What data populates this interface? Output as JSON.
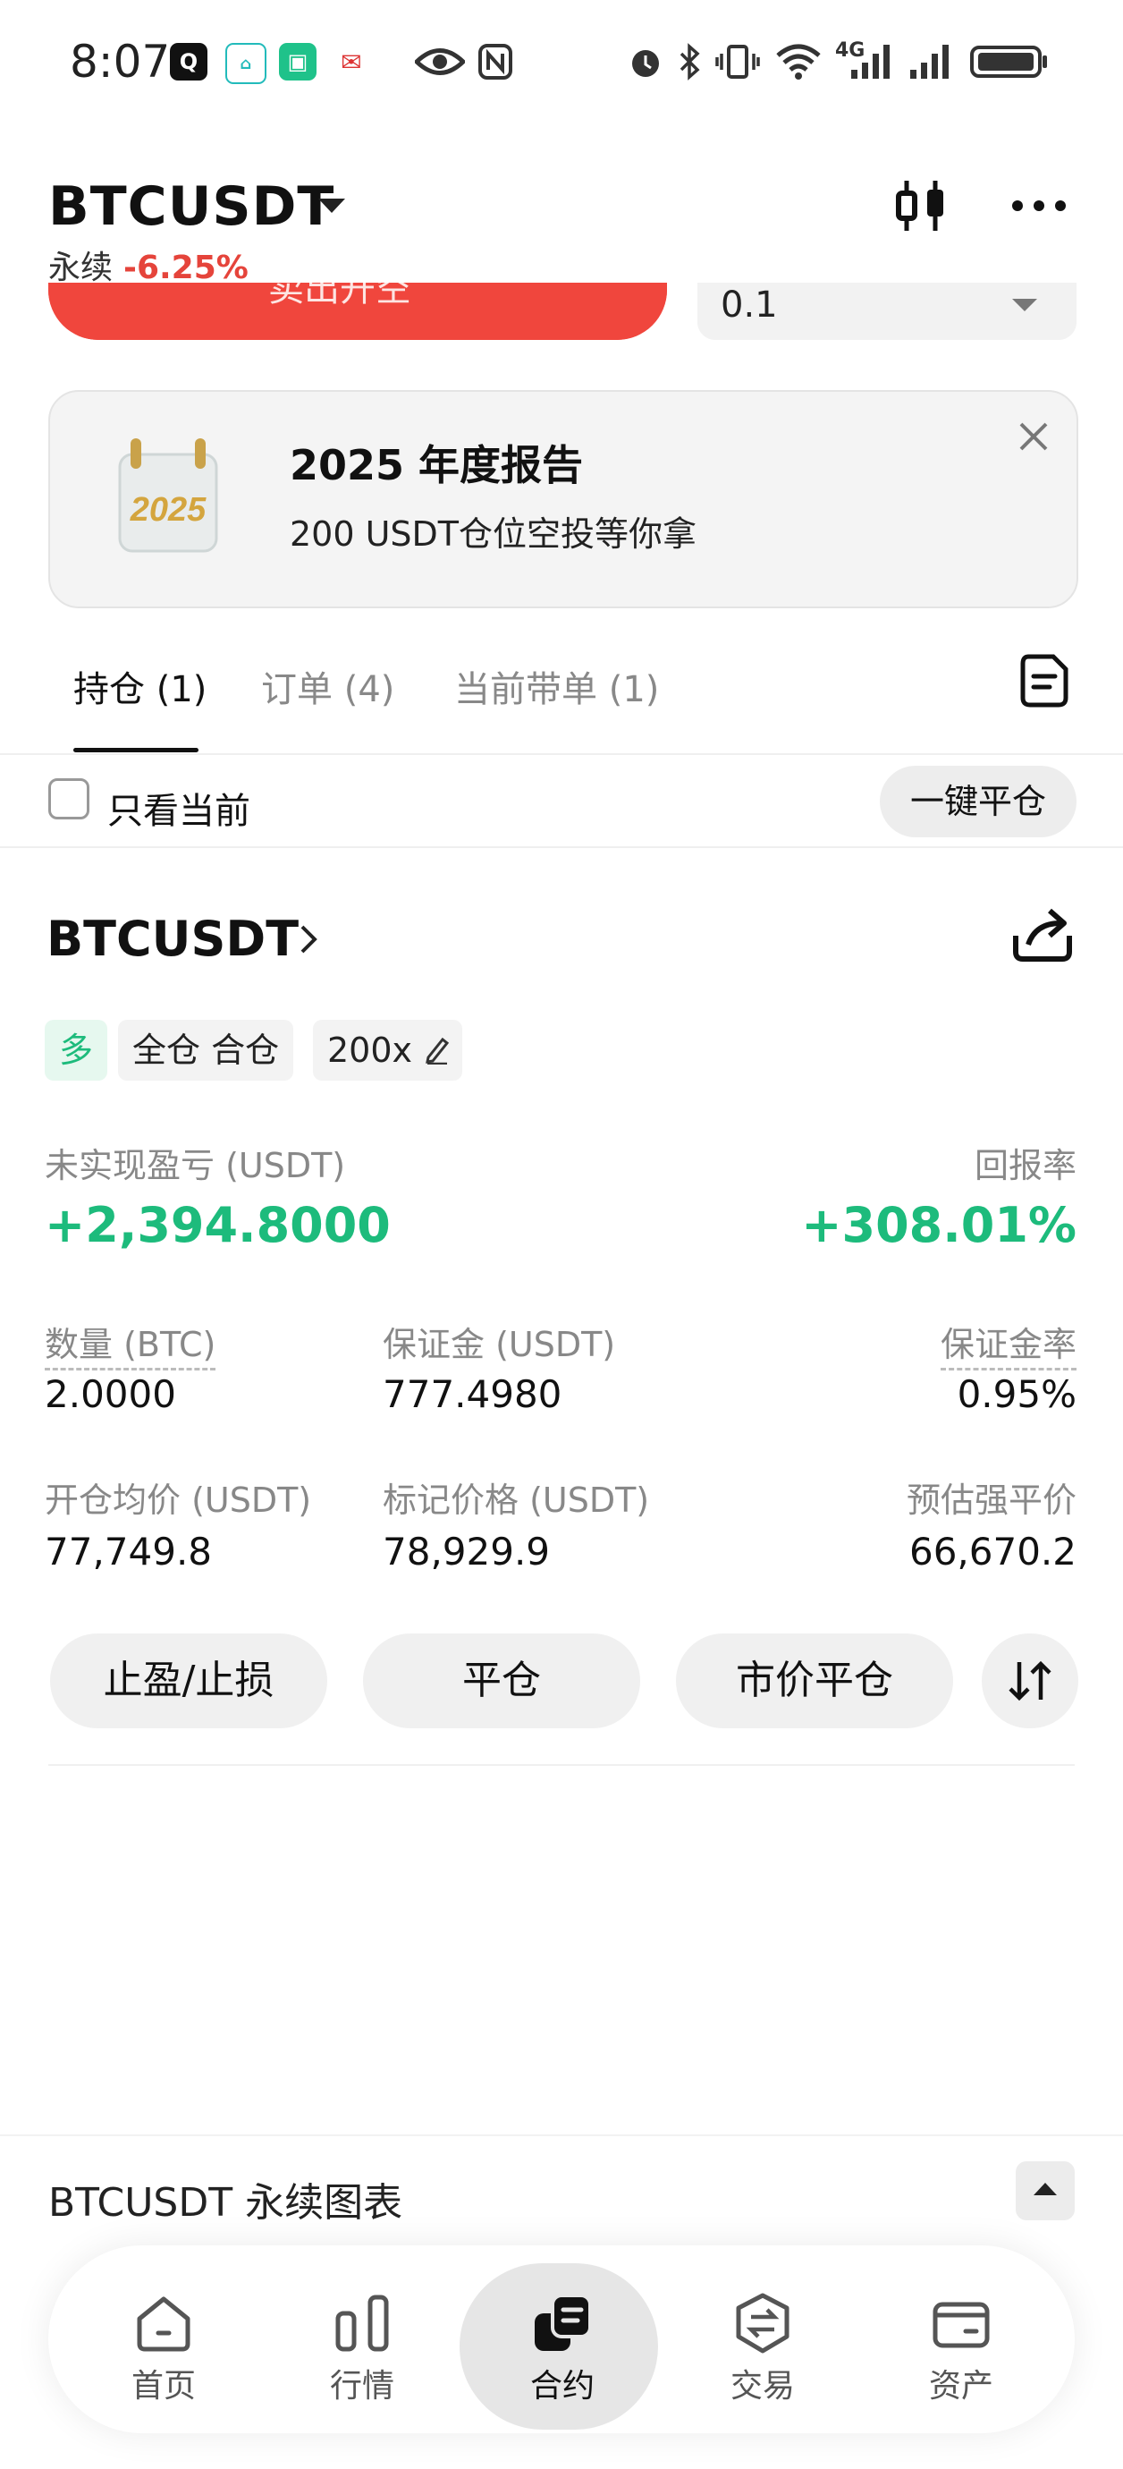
{
  "status_bar": {
    "time": "8:07",
    "network": "4G"
  },
  "header": {
    "pair": "BTCUSDT",
    "contract_type": "永续",
    "change": "-6.25%"
  },
  "order_form_partial": {
    "sell_button_label": "卖出开空",
    "quantity_value": "0.1"
  },
  "banner": {
    "year_art": "2025",
    "title": "2025 年度报告",
    "subtitle": "200 USDT仓位空投等你拿"
  },
  "tabs": [
    {
      "label": "持仓 (1)",
      "active": true
    },
    {
      "label": "订单 (4)",
      "active": false
    },
    {
      "label": "当前带单 (1)",
      "active": false
    }
  ],
  "filter": {
    "only_current_label": "只看当前",
    "only_current_checked": false,
    "close_all_label": "一键平仓"
  },
  "position": {
    "symbol": "BTCUSDT",
    "tags": {
      "side": "多",
      "margin_mode": "全仓 合仓",
      "leverage": "200x"
    },
    "pnl_label": "未实现盈亏 (USDT)",
    "pnl_value": "+2,394.8000",
    "roi_label": "回报率",
    "roi_value": "+308.01%",
    "fields": {
      "qty_label": "数量 (BTC)",
      "qty_value": "2.0000",
      "margin_label": "保证金 (USDT)",
      "margin_value": "777.4980",
      "margin_rate_label": "保证金率",
      "margin_rate_value": "0.95%",
      "entry_label": "开仓均价 (USDT)",
      "entry_value": "77,749.8",
      "mark_label": "标记价格 (USDT)",
      "mark_value": "78,929.9",
      "liq_label": "预估强平价",
      "liq_value": "66,670.2"
    },
    "actions": {
      "tp_sl": "止盈/止损",
      "close": "平仓",
      "market_close": "市价平仓"
    }
  },
  "chart_bar": {
    "label": "BTCUSDT 永续图表"
  },
  "nav": [
    {
      "label": "首页",
      "icon": "home-icon",
      "active": false
    },
    {
      "label": "行情",
      "icon": "market-bars-icon",
      "active": false
    },
    {
      "label": "合约",
      "icon": "futures-icon",
      "active": true
    },
    {
      "label": "交易",
      "icon": "exchange-icon",
      "active": false
    },
    {
      "label": "资产",
      "icon": "wallet-icon",
      "active": false
    }
  ],
  "colors": {
    "profit_green": "#1dbb7c",
    "loss_red": "#e5443b",
    "sell_red": "#f0463d"
  }
}
